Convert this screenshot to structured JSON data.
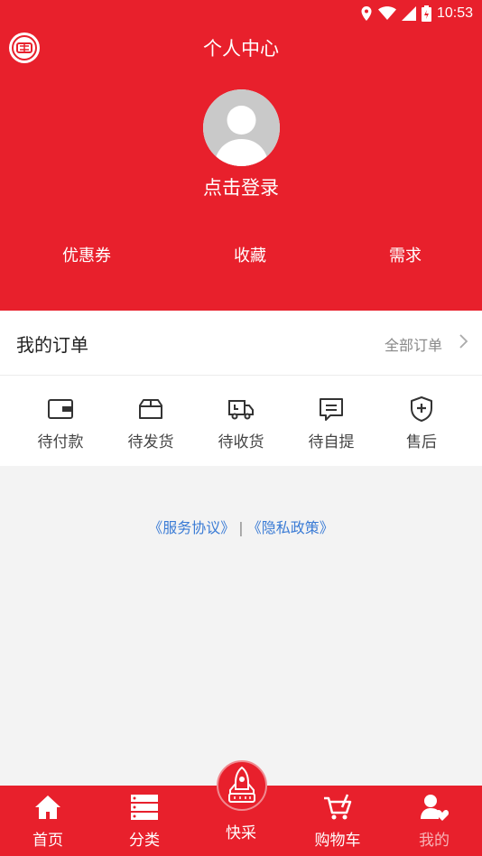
{
  "status_bar": {
    "time": "10:53"
  },
  "header": {
    "title": "个人中心",
    "login_text": "点击登录",
    "quick_links": [
      "优惠券",
      "收藏",
      "需求"
    ]
  },
  "orders": {
    "title": "我的订单",
    "all_label": "全部订单",
    "statuses": [
      "待付款",
      "待发货",
      "待收货",
      "待自提",
      "售后"
    ]
  },
  "footer_links": {
    "service": "《服务协议》",
    "separator": "|",
    "privacy": "《隐私政策》"
  },
  "tabbar": {
    "items": [
      "首页",
      "分类",
      "快采",
      "购物车",
      "我的"
    ],
    "active": "我的"
  },
  "colors": {
    "brand_red": "#e8202c",
    "link_blue": "#3a7bd5"
  }
}
